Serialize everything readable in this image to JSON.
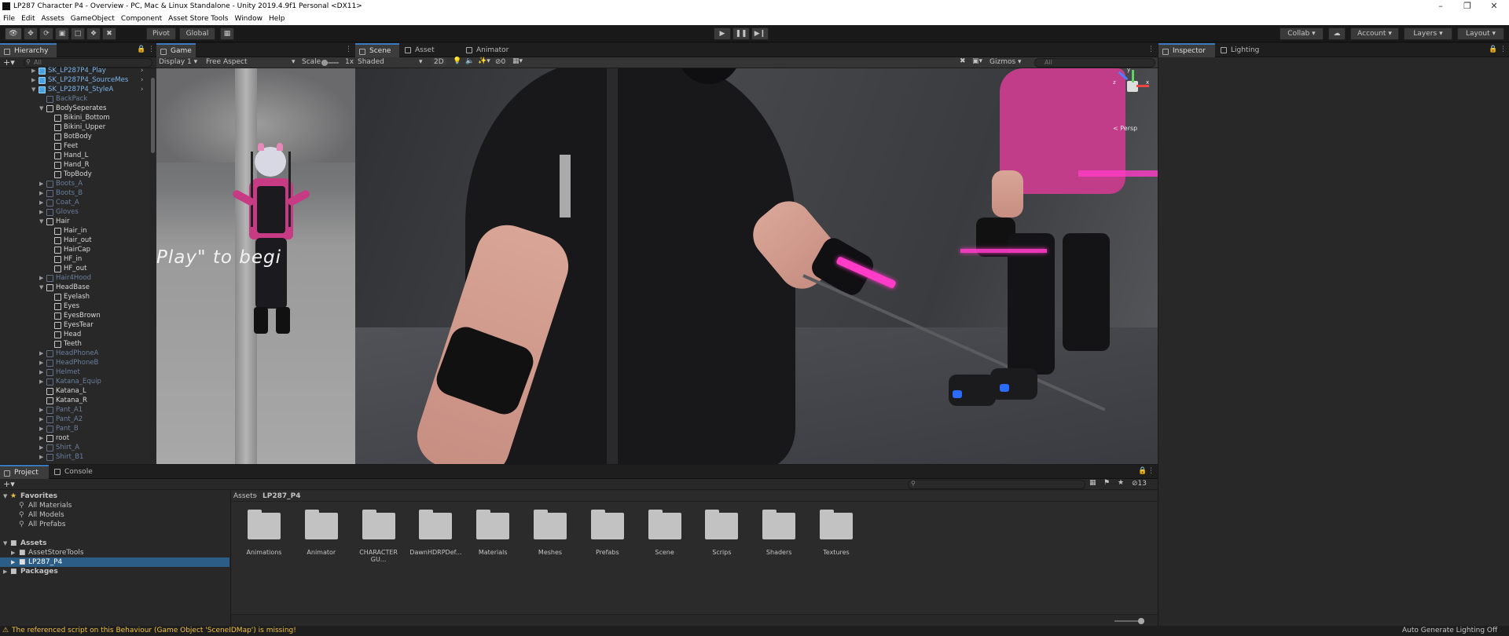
{
  "window": {
    "title": "LP287 Character P4 - Overview - PC, Mac & Linux Standalone - Unity 2019.4.9f1 Personal <DX11>",
    "controls": [
      "–",
      "❐",
      "✕"
    ]
  },
  "menu": [
    "File",
    "Edit",
    "Assets",
    "GameObject",
    "Component",
    "Asset Store Tools",
    "Window",
    "Help"
  ],
  "toolbar": {
    "pivot": "Pivot",
    "global": "Global",
    "collab": "Collab",
    "account": "Account",
    "layers": "Layers",
    "layout": "Layout"
  },
  "hierarchy": {
    "tab": "Hierarchy",
    "search_placeholder": "All",
    "items": [
      {
        "label": "SK_LP287P4_Play",
        "depth": 0,
        "arrow": "right",
        "state": "prefab",
        "blue": true
      },
      {
        "label": "SK_LP287P4_SourceMes",
        "depth": 0,
        "arrow": "right",
        "state": "prefab",
        "blue": true
      },
      {
        "label": "SK_LP287P4_StyleA",
        "depth": 0,
        "arrow": "down",
        "state": "prefab",
        "blue": true
      },
      {
        "label": "BackPack",
        "depth": 1,
        "arrow": "",
        "state": "inactive"
      },
      {
        "label": "BodySeperates",
        "depth": 1,
        "arrow": "down",
        "state": "active"
      },
      {
        "label": "Bikini_Bottom",
        "depth": 2,
        "arrow": "",
        "state": "active"
      },
      {
        "label": "Bikini_Upper",
        "depth": 2,
        "arrow": "",
        "state": "active"
      },
      {
        "label": "BotBody",
        "depth": 2,
        "arrow": "",
        "state": "active"
      },
      {
        "label": "Feet",
        "depth": 2,
        "arrow": "",
        "state": "active"
      },
      {
        "label": "Hand_L",
        "depth": 2,
        "arrow": "",
        "state": "active"
      },
      {
        "label": "Hand_R",
        "depth": 2,
        "arrow": "",
        "state": "active"
      },
      {
        "label": "TopBody",
        "depth": 2,
        "arrow": "",
        "state": "active"
      },
      {
        "label": "Boots_A",
        "depth": 1,
        "arrow": "right",
        "state": "inactive"
      },
      {
        "label": "Boots_B",
        "depth": 1,
        "arrow": "right",
        "state": "inactive"
      },
      {
        "label": "Coat_A",
        "depth": 1,
        "arrow": "right",
        "state": "inactive"
      },
      {
        "label": "Gloves",
        "depth": 1,
        "arrow": "right",
        "state": "inactive"
      },
      {
        "label": "Hair",
        "depth": 1,
        "arrow": "down",
        "state": "active"
      },
      {
        "label": "Hair_in",
        "depth": 2,
        "arrow": "",
        "state": "active"
      },
      {
        "label": "Hair_out",
        "depth": 2,
        "arrow": "",
        "state": "active"
      },
      {
        "label": "HairCap",
        "depth": 2,
        "arrow": "",
        "state": "active"
      },
      {
        "label": "HF_in",
        "depth": 2,
        "arrow": "",
        "state": "active"
      },
      {
        "label": "HF_out",
        "depth": 2,
        "arrow": "",
        "state": "active"
      },
      {
        "label": "Hair4Hood",
        "depth": 1,
        "arrow": "right",
        "state": "inactive"
      },
      {
        "label": "HeadBase",
        "depth": 1,
        "arrow": "down",
        "state": "active"
      },
      {
        "label": "Eyelash",
        "depth": 2,
        "arrow": "",
        "state": "active"
      },
      {
        "label": "Eyes",
        "depth": 2,
        "arrow": "",
        "state": "active"
      },
      {
        "label": "EyesBrown",
        "depth": 2,
        "arrow": "",
        "state": "active"
      },
      {
        "label": "EyesTear",
        "depth": 2,
        "arrow": "",
        "state": "active"
      },
      {
        "label": "Head",
        "depth": 2,
        "arrow": "",
        "state": "active"
      },
      {
        "label": "Teeth",
        "depth": 2,
        "arrow": "",
        "state": "active"
      },
      {
        "label": "HeadPhoneA",
        "depth": 1,
        "arrow": "right",
        "state": "inactive"
      },
      {
        "label": "HeadPhoneB",
        "depth": 1,
        "arrow": "right",
        "state": "inactive"
      },
      {
        "label": "Helmet",
        "depth": 1,
        "arrow": "right",
        "state": "inactive"
      },
      {
        "label": "Katana_Equip",
        "depth": 1,
        "arrow": "right",
        "state": "inactive"
      },
      {
        "label": "Katana_L",
        "depth": 1,
        "arrow": "",
        "state": "active"
      },
      {
        "label": "Katana_R",
        "depth": 1,
        "arrow": "",
        "state": "active"
      },
      {
        "label": "Pant_A1",
        "depth": 1,
        "arrow": "right",
        "state": "inactive"
      },
      {
        "label": "Pant_A2",
        "depth": 1,
        "arrow": "right",
        "state": "inactive"
      },
      {
        "label": "Pant_B",
        "depth": 1,
        "arrow": "right",
        "state": "inactive"
      },
      {
        "label": "root",
        "depth": 1,
        "arrow": "right",
        "state": "active"
      },
      {
        "label": "Shirt_A",
        "depth": 1,
        "arrow": "right",
        "state": "inactive"
      },
      {
        "label": "Shirt_B1",
        "depth": 1,
        "arrow": "right",
        "state": "inactive"
      }
    ]
  },
  "game": {
    "tab": "Game",
    "display": "Display 1",
    "aspect": "Free Aspect",
    "scale_label": "Scale",
    "scale_value": "1x",
    "overlay_text": "Play\" to begi"
  },
  "scene": {
    "tabs": [
      "Scene",
      "Asset Store",
      "Animator"
    ],
    "shading": "Shaded",
    "mode_2d": "2D",
    "hidden_count": "0",
    "gizmos": "Gizmos",
    "search_placeholder": "All",
    "persp": "< Persp",
    "gizmo_axes": [
      "x",
      "y",
      "z"
    ]
  },
  "inspector": {
    "tabs": [
      "Inspector",
      "Lighting"
    ]
  },
  "project": {
    "tabs": [
      "Project",
      "Console"
    ],
    "breadcrumb": [
      "Assets",
      "LP287_P4"
    ],
    "layer_count": "13",
    "favorites_label": "Favorites",
    "favorites": [
      "All Materials",
      "All Models",
      "All Prefabs"
    ],
    "assets_label": "Assets",
    "asset_children": [
      "AssetStoreTools",
      "LP287_P4"
    ],
    "packages_label": "Packages",
    "folders": [
      "Animations",
      "Animator",
      "CHARACTER GU...",
      "DawnHDRPDef...",
      "Materials",
      "Meshes",
      "Prefabs",
      "Scene",
      "Scrips",
      "Shaders",
      "Textures"
    ]
  },
  "status": {
    "warning": "The referenced script on this Behaviour (Game Object 'SceneIDMap') is missing!",
    "lighting": "Auto Generate Lighting Off"
  },
  "colors": {
    "accent": "#3a79bb",
    "selection": "#2c5d87",
    "warning": "#f0c040",
    "neon_pink": "#ff3cc8"
  }
}
